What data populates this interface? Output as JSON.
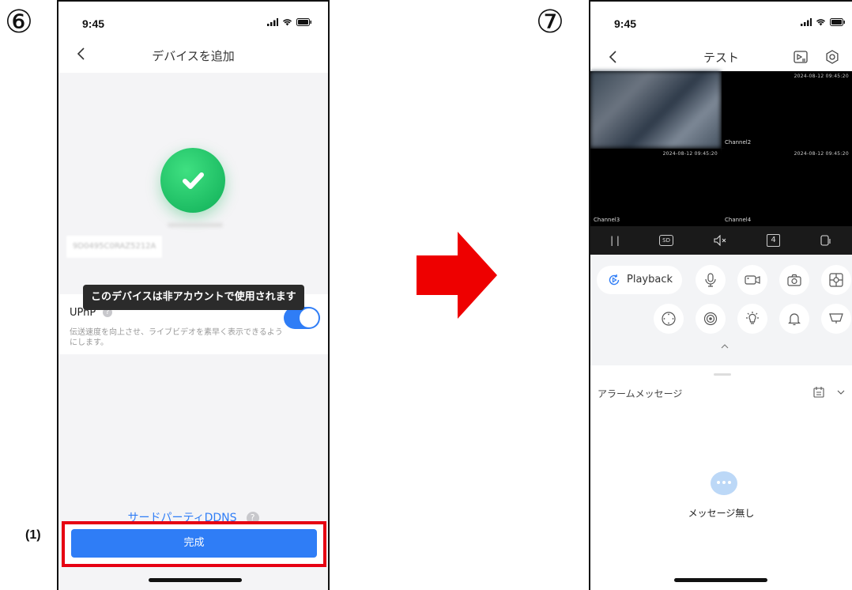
{
  "steps": {
    "left": "⑥",
    "right": "⑦"
  },
  "annotation": "(1)",
  "status": {
    "time": "9:45"
  },
  "add_device": {
    "title": "デバイスを追加",
    "device_id": "9D0495C0RAZ5212A",
    "toast": "このデバイスは非アカウントで使用されます",
    "upnp": {
      "label": "UPnP",
      "help": "?",
      "description": "伝送速度を向上させ、ライブビデオを素早く表示できるようにします。",
      "enabled": true
    },
    "ddns_link": "サードパーティDDNS",
    "ddns_help": "?",
    "done_button": "完成"
  },
  "live_view": {
    "title": "テスト",
    "channels": [
      {
        "name": "",
        "timestamp": "",
        "has_image": true
      },
      {
        "name": "Channel2",
        "timestamp": "2024-08-12 09:45:20",
        "has_image": false
      },
      {
        "name": "Channel3",
        "timestamp": "2024-08-12 09:45:20",
        "has_image": false
      },
      {
        "name": "Channel4",
        "timestamp": "2024-08-12 09:45:20",
        "has_image": false
      }
    ],
    "toolbar": {
      "pause": "| |",
      "quality": "SD",
      "split": "4"
    },
    "playback_label": "Playback",
    "alarm_title": "アラームメッセージ",
    "no_message": "メッセージ無し"
  },
  "colors": {
    "accent": "#2f7df6",
    "success": "#1cc066",
    "highlight": "#e60012",
    "arrow": "#ee0000"
  }
}
